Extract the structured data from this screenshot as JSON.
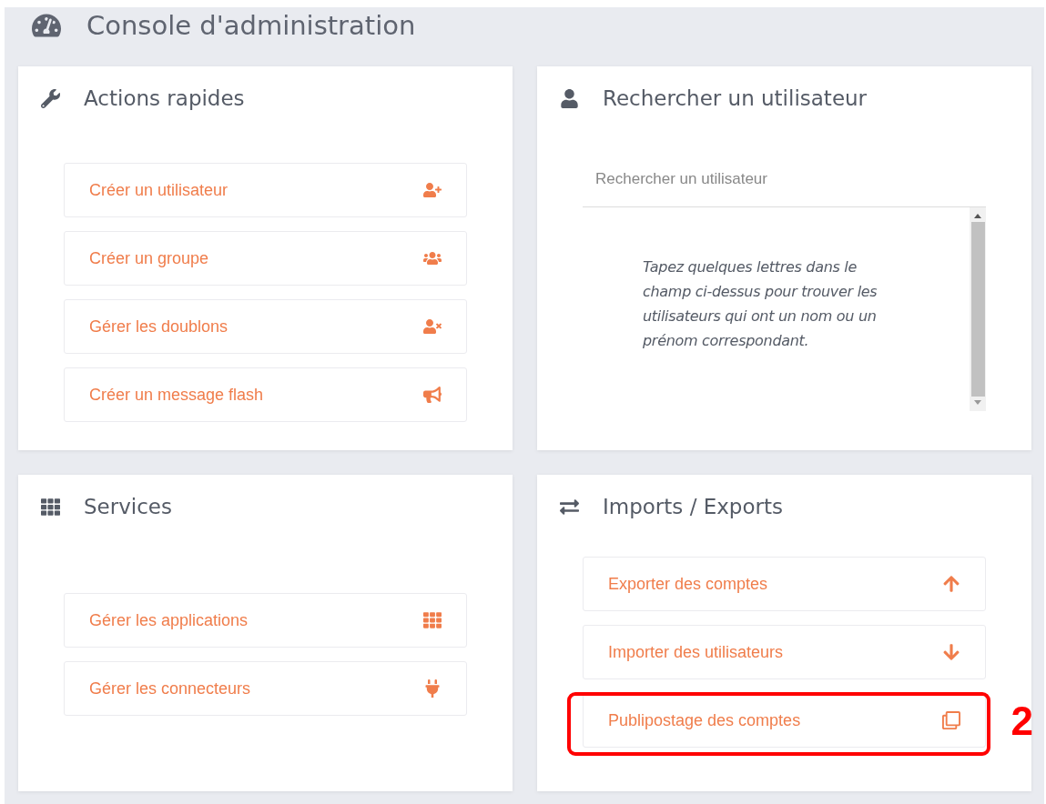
{
  "header": {
    "title": "Console d'administration"
  },
  "cards": [
    {
      "kind": "actions",
      "title": "Actions rapides",
      "items": [
        {
          "label": "Créer un utilisateur"
        },
        {
          "label": "Créer un groupe"
        },
        {
          "label": "Gérer les doublons"
        },
        {
          "label": "Créer un message flash"
        }
      ]
    },
    {
      "kind": "search",
      "title": "Rechercher un utilisateur",
      "placeholder": "Rechercher un utilisateur",
      "hint": "Tapez quelques lettres dans le champ ci-dessus pour trouver les utilisateurs qui ont un nom ou un prénom correspondant."
    },
    {
      "kind": "actions",
      "title": "Services",
      "items": [
        {
          "label": "Gérer les applications"
        },
        {
          "label": "Gérer les connecteurs"
        }
      ]
    },
    {
      "kind": "actions",
      "title": "Imports / Exports",
      "items": [
        {
          "label": "Exporter des comptes"
        },
        {
          "label": "Importer des utilisateurs"
        },
        {
          "label": "Publipostage des comptes",
          "callout": "2"
        }
      ]
    }
  ]
}
